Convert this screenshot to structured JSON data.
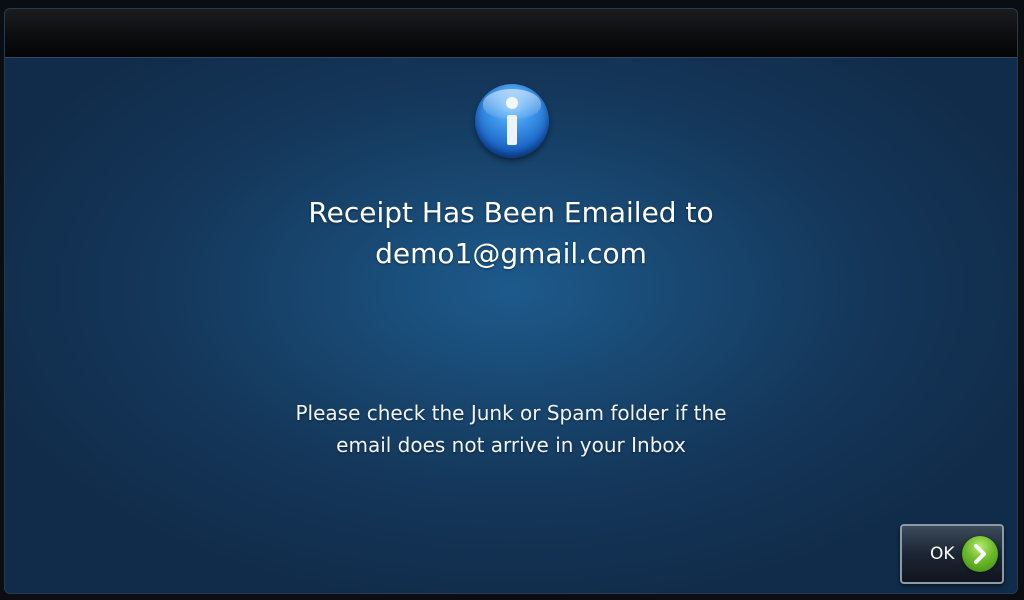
{
  "dialog": {
    "heading_line1": "Receipt Has Been Emailed to",
    "heading_line2": "demo1@gmail.com",
    "note_line1": "Please check the Junk or Spam folder if the",
    "note_line2": "email does not arrive in your Inbox",
    "icon": "info-icon"
  },
  "ok_button": {
    "label": "OK",
    "icon": "chevron-right-icon"
  },
  "colors": {
    "background_center": "#1d5a8c",
    "background_edge": "#112c4a",
    "title_bar": "#0b0c0e",
    "text": "#ffffff",
    "accent_green": "#6dbb2a",
    "info_blue": "#3d95ea"
  }
}
